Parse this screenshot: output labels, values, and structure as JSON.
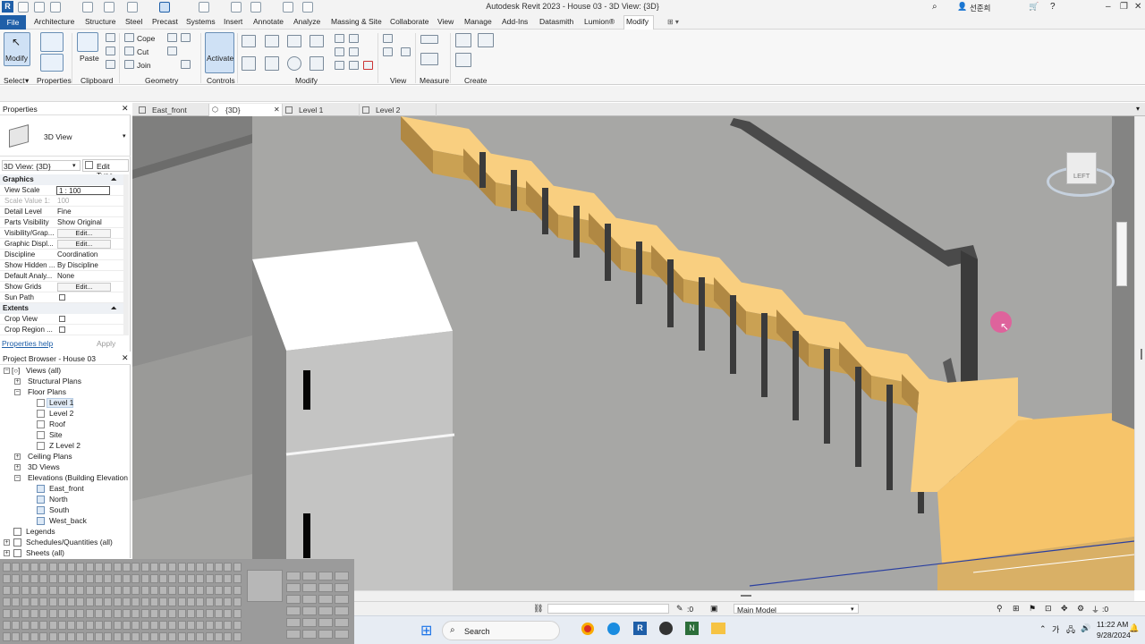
{
  "window": {
    "title": "Autodesk Revit 2023 - House 03 - 3D View: {3D}",
    "user": "선준희"
  },
  "menu": {
    "file": "File",
    "items": [
      "Architecture",
      "Structure",
      "Steel",
      "Precast",
      "Systems",
      "Insert",
      "Annotate",
      "Analyze",
      "Massing & Site",
      "Collaborate",
      "View",
      "Manage",
      "Add-Ins",
      "Datasmith",
      "Lumion®",
      "Modify"
    ],
    "active": "Modify"
  },
  "ribbon": {
    "modify": "Modify",
    "select": "Select",
    "properties": "Properties",
    "paste": "Paste",
    "clipboard": "Clipboard",
    "cope": "Cope",
    "cut": "Cut",
    "join": "Join",
    "geometry": "Geometry",
    "activate": "Activate",
    "controls": "Controls",
    "modify_group": "Modify",
    "view": "View",
    "measure": "Measure",
    "create": "Create"
  },
  "properties": {
    "header": "Properties",
    "type_name": "3D View",
    "selector": "3D View: {3D}",
    "edit_type": "Edit Type",
    "graphics_group": "Graphics",
    "rows": [
      {
        "k": "View Scale",
        "v": "1 : 100"
      },
      {
        "k": "Scale Value    1:",
        "v": "100"
      },
      {
        "k": "Detail Level",
        "v": "Fine"
      },
      {
        "k": "Parts Visibility",
        "v": "Show Original"
      },
      {
        "k": "Visibility/Grap...",
        "v": "Edit..."
      },
      {
        "k": "Graphic Displ...",
        "v": "Edit..."
      },
      {
        "k": "Discipline",
        "v": "Coordination"
      },
      {
        "k": "Show Hidden ...",
        "v": "By Discipline"
      },
      {
        "k": "Default Analy...",
        "v": "None"
      },
      {
        "k": "Show Grids",
        "v": "Edit..."
      },
      {
        "k": "Sun Path",
        "v": ""
      }
    ],
    "extents_group": "Extents",
    "extents_rows": [
      {
        "k": "Crop View",
        "v": ""
      },
      {
        "k": "Crop Region ...",
        "v": ""
      }
    ],
    "help": "Properties help",
    "apply": "Apply"
  },
  "browser": {
    "header": "Project Browser - House 03",
    "nodes": [
      {
        "label": "Views (all)"
      },
      {
        "label": "Structural Plans"
      },
      {
        "label": "Floor Plans"
      },
      {
        "label": "Level 1"
      },
      {
        "label": "Level 2"
      },
      {
        "label": "Roof"
      },
      {
        "label": "Site"
      },
      {
        "label": "Z Level 2"
      },
      {
        "label": "Ceiling Plans"
      },
      {
        "label": "3D Views"
      },
      {
        "label": "Elevations (Building Elevation"
      },
      {
        "label": "East_front"
      },
      {
        "label": "North"
      },
      {
        "label": "South"
      },
      {
        "label": "West_back"
      },
      {
        "label": "Legends"
      },
      {
        "label": "Schedules/Quantities (all)"
      },
      {
        "label": "Sheets (all)"
      }
    ]
  },
  "tabs": [
    "East_front",
    "{3D}",
    "Level 1",
    "Level 2"
  ],
  "active_tab": "{3D}",
  "viewcube": {
    "face": "LEFT"
  },
  "status": {
    "workset_value": ":0",
    "model": "Main Model",
    "filter": ":0"
  },
  "taskbar": {
    "search": "Search",
    "time": "11:22 AM",
    "date": "9/28/2024"
  },
  "colors": {
    "file_tab": "#1f5fa8",
    "tread": "#f9cf80",
    "riser": "#caa153",
    "rail": "#3b3b3b",
    "background": "#a5a5a3",
    "cursor_highlight": "#e8579a"
  }
}
